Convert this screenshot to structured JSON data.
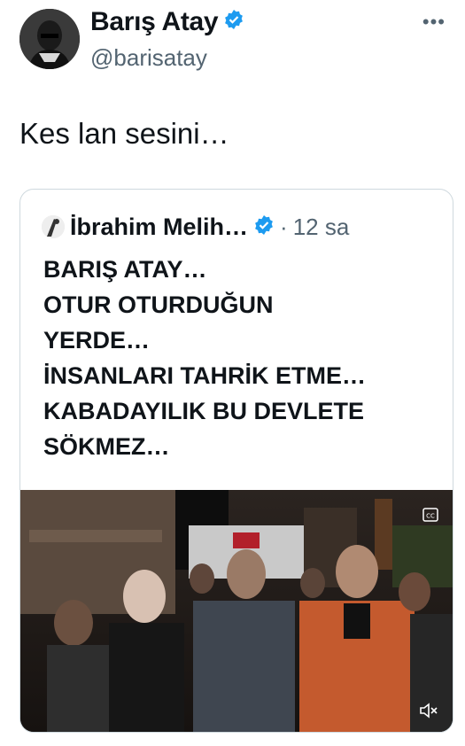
{
  "author": {
    "display_name": "Barış Atay",
    "handle": "@barisatay",
    "verified_icon": "verified-badge-icon"
  },
  "more_icon": "more-horizontal-icon",
  "tweet": {
    "text": "Kes lan sesini…"
  },
  "quoted": {
    "display_name": "İbrahim Melih…",
    "separator": "·",
    "time": "12 sa",
    "lines": [
      "BARIŞ ATAY…",
      "OTUR OTURDUĞUN",
      "YERDE…",
      "İNSANLARI TAHRİK ETME…",
      "KABADAYILIK BU DEVLETE",
      "SÖKMEZ…"
    ],
    "media_icons": [
      "captions-icon",
      "muted-speaker-icon"
    ]
  },
  "colors": {
    "verified": "#1d9bf0",
    "secondary_text": "#536471",
    "border": "#cfd9de"
  }
}
